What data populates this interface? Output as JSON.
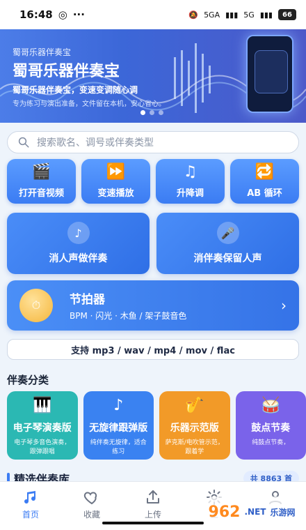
{
  "status_bar": {
    "time": "16:48",
    "network": "5GA",
    "network2": "5G",
    "battery": "66"
  },
  "banner": {
    "small_title": "蜀哥乐器伴奏宝",
    "title": "蜀哥乐器伴奏宝",
    "subtitle": "蜀哥乐器伴奏宝，变速变调随心调",
    "note": "专为练习与演出准备，文件留在本机，安心省心。"
  },
  "search": {
    "placeholder": "搜索歌名、调号或伴奏类型"
  },
  "tools": [
    {
      "label": "打开音视频",
      "icon": "clapperboard-icon"
    },
    {
      "label": "变速播放",
      "icon": "fast-forward-icon"
    },
    {
      "label": "升降调",
      "icon": "music-note-icon"
    },
    {
      "label": "AB 循环",
      "icon": "repeat-icon"
    }
  ],
  "big_cards": [
    {
      "label": "消人声做伴奏",
      "icon": "music-note-icon"
    },
    {
      "label": "消伴奏保留人声",
      "icon": "microphone-icon"
    }
  ],
  "metronome": {
    "title": "节拍器",
    "subtitle": "BPM · 闪光 · 木鱼 / 架子鼓音色"
  },
  "formats": {
    "text": "支持 mp3 / wav / mp4 / mov / flac"
  },
  "section": {
    "title": "伴奏分类"
  },
  "categories": [
    {
      "title": "电子琴演奏版",
      "desc": "电子琴多音色演奏，跟弹跟唱",
      "icon": "piano-icon",
      "color": "#2bb8b3"
    },
    {
      "title": "无旋律跟弹版",
      "desc": "纯伴奏无旋律，适合练习",
      "icon": "music-note-icon",
      "color": "#3a82f1"
    },
    {
      "title": "乐器示范版",
      "desc": "萨克斯/电吹管示范，跟着学",
      "icon": "saxophone-icon",
      "color": "#f29a28"
    },
    {
      "title": "鼓点节奏",
      "desc": "纯鼓点节奏，",
      "icon": "drum-icon",
      "color": "#7a63ea"
    }
  ],
  "picked": {
    "title": "精选伴奏库",
    "count": "共 8863 首"
  },
  "tabbar": [
    {
      "label": "首页",
      "icon": "music-note-icon",
      "active": true
    },
    {
      "label": "收藏",
      "icon": "heart-icon",
      "active": false
    },
    {
      "label": "上传",
      "icon": "upload-icon",
      "active": false
    },
    {
      "label": "工",
      "icon": "gear-icon",
      "active": false
    },
    {
      "label": "",
      "icon": "user-icon",
      "active": false
    }
  ],
  "watermark": {
    "big": "962",
    "small": "乐游网",
    "suffix": ".NET"
  }
}
